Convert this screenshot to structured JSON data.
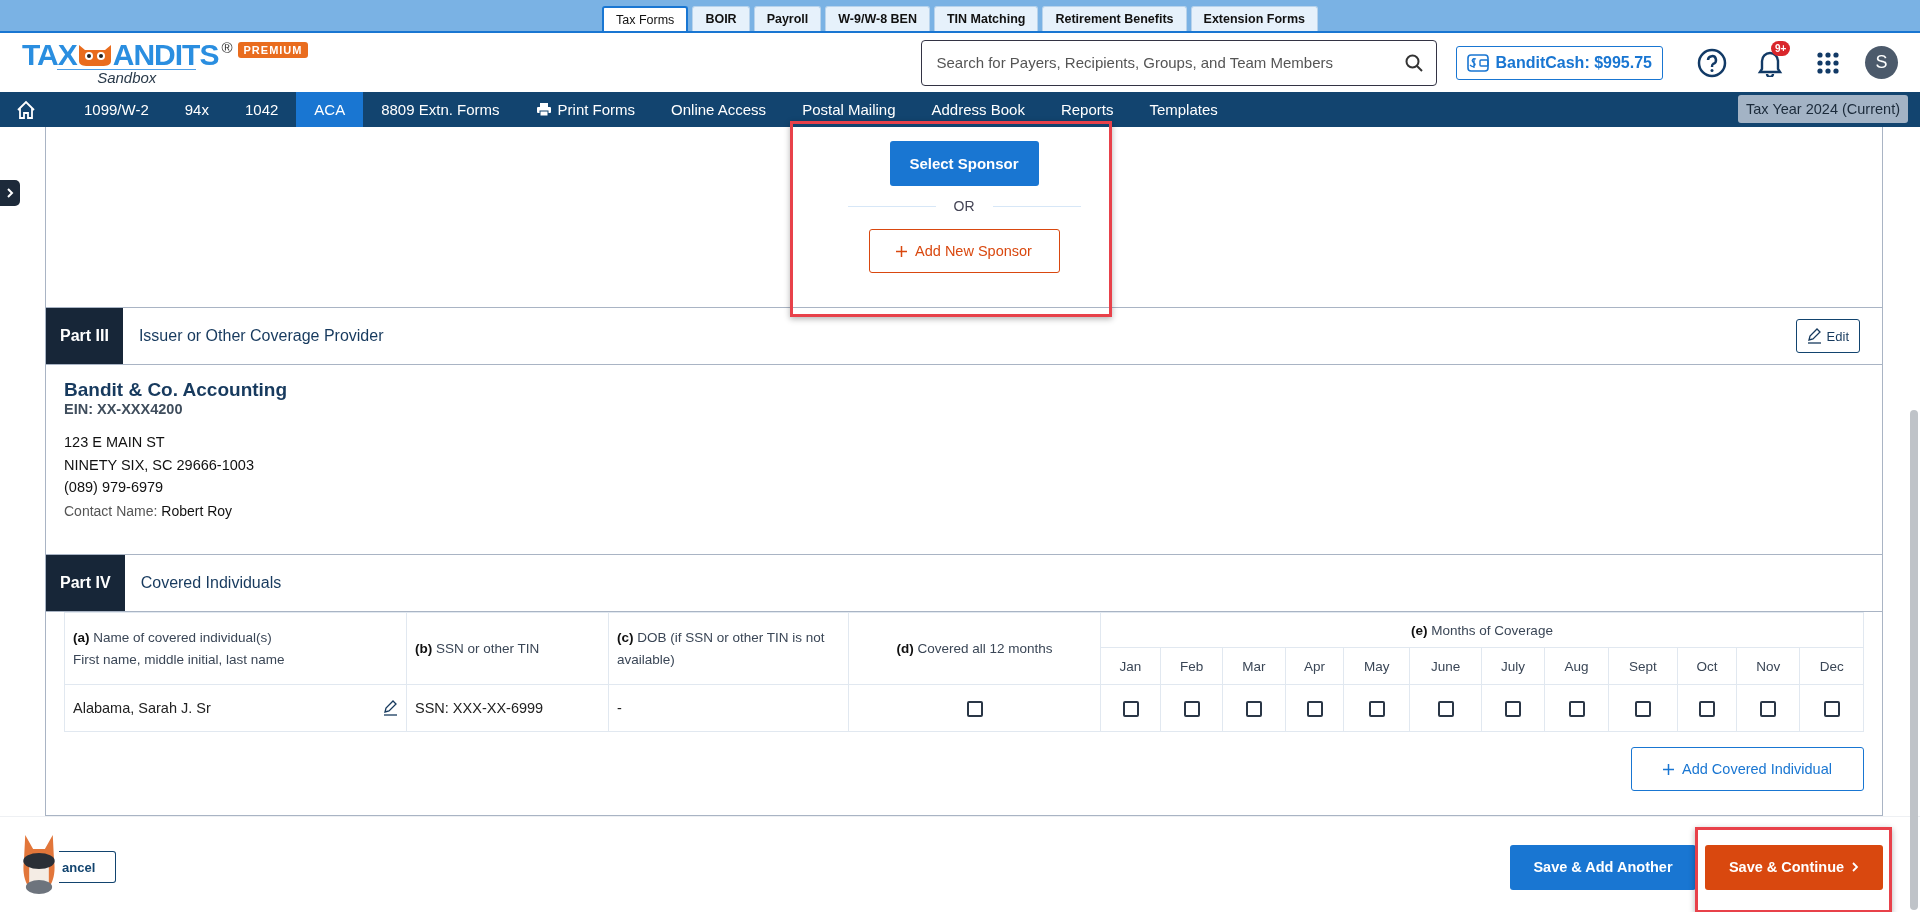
{
  "top_tabs": [
    {
      "label": "Tax Forms",
      "selected": true
    },
    {
      "label": "BOIR",
      "selected": false
    },
    {
      "label": "Payroll",
      "selected": false
    },
    {
      "label": "W-9/W-8 BEN",
      "selected": false
    },
    {
      "label": "TIN Matching",
      "selected": false
    },
    {
      "label": "Retirement Benefits",
      "selected": false
    },
    {
      "label": "Extension Forms",
      "selected": false
    }
  ],
  "logo": {
    "left": "TAX",
    "right": "ANDITS",
    "mark": "®",
    "sub": "Sandbox",
    "badge": "PREMIUM"
  },
  "search": {
    "placeholder": "Search for Payers, Recipients, Groups, and Team Members"
  },
  "bandit_cash": "BanditCash: $995.75",
  "notifications_badge": "9+",
  "avatar": "S",
  "nav": {
    "items": [
      {
        "label": "1099/W-2",
        "selected": false
      },
      {
        "label": "94x",
        "selected": false
      },
      {
        "label": "1042",
        "selected": false
      },
      {
        "label": "ACA",
        "selected": true
      },
      {
        "label": "8809 Extn. Forms",
        "selected": false
      },
      {
        "label": "Print Forms",
        "selected": false,
        "kind": "print"
      },
      {
        "label": "Online Access",
        "selected": false
      },
      {
        "label": "Postal Mailing",
        "selected": false
      },
      {
        "label": "Address Book",
        "selected": false
      },
      {
        "label": "Reports",
        "selected": false
      },
      {
        "label": "Templates",
        "selected": false
      }
    ],
    "tax_year": "Tax Year 2024 (Current)"
  },
  "sponsor": {
    "select_button": "Select Sponsor",
    "or_text": "OR",
    "add_button": "Add New Sponsor"
  },
  "part3": {
    "part": "Part III",
    "title": "Issuer or Other Coverage Provider",
    "edit_button": "Edit",
    "name": "Bandit & Co. Accounting",
    "ein": "EIN: XX-XXX4200",
    "address": [
      "123 E MAIN ST",
      "NINETY SIX, SC 29666-1003",
      "(089) 979-6979"
    ],
    "contact_label": "Contact Name:",
    "contact_value": "Robert Roy"
  },
  "part4": {
    "part": "Part IV",
    "title": "Covered Individuals",
    "columns": {
      "a": [
        "**(a)** Name of covered individual(s)",
        "First name, middle initial, last name"
      ],
      "b": "**(b)** SSN or other TIN",
      "c": "**(c)**  DOB (if SSN or other TIN is not available)",
      "d": "**(d)**  Covered all 12 months",
      "e": "**(e)**  Months of Coverage"
    },
    "months": [
      "Jan",
      "Feb",
      "Mar",
      "Apr",
      "May",
      "June",
      "July",
      "Aug",
      "Sept",
      "Oct",
      "Nov",
      "Dec"
    ],
    "rows": [
      {
        "name": "Alabama, Sarah J. Sr",
        "ssn": "SSN: XXX-XX-6999",
        "dob": "-",
        "all_12": false,
        "months_checked": [
          false,
          false,
          false,
          false,
          false,
          false,
          false,
          false,
          false,
          false,
          false,
          false
        ]
      }
    ],
    "add_button": "Add Covered Individual"
  },
  "footer": {
    "cancel": "ancel",
    "save_another": "Save & Add Another",
    "save_continue": "Save & Continue"
  }
}
